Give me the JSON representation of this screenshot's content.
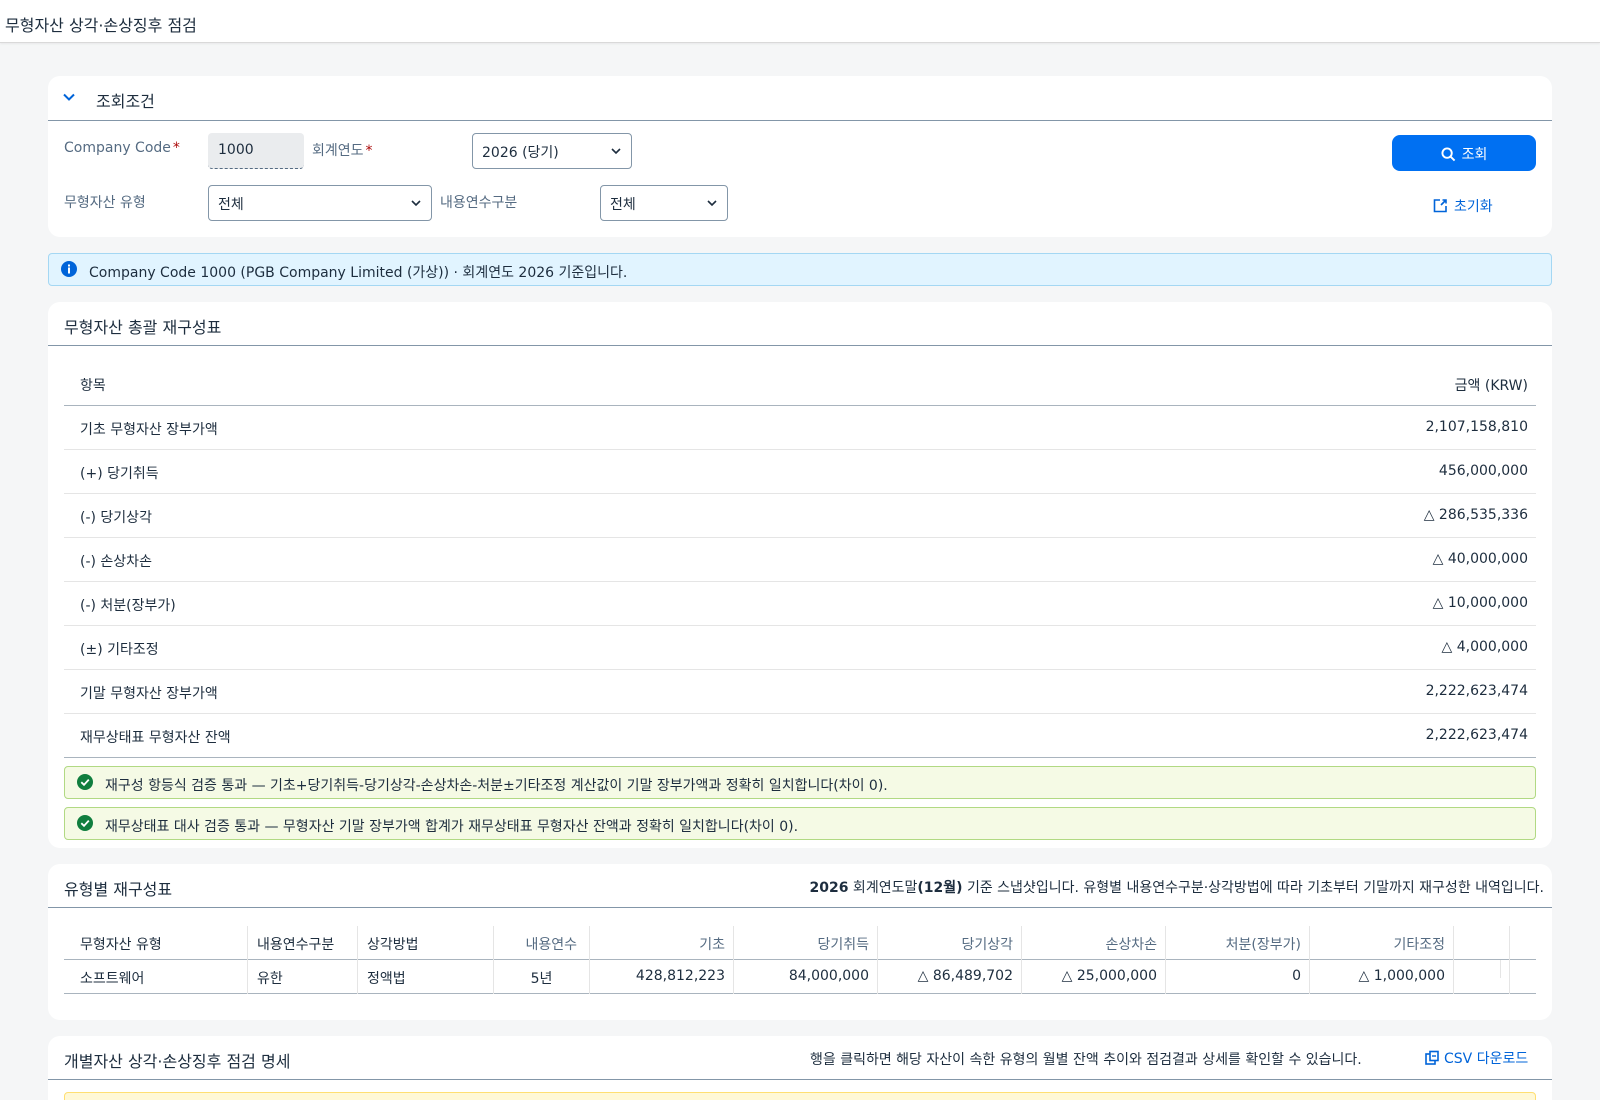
{
  "app": {
    "title": "무형자산 상각·손상징후 점검"
  },
  "filter": {
    "header": "조회조건",
    "company_code_label": "Company Code",
    "company_code_value": "1000",
    "fiscal_year_label": "회계연도",
    "fiscal_year_value": "2026 (당기)",
    "asset_type_label": "무형자산 유형",
    "asset_type_value": "전체",
    "useful_life_label": "내용연수구분",
    "useful_life_value": "전체",
    "search_button": "조회",
    "reset_button": "초기화",
    "required_mark": "*"
  },
  "info": {
    "text": "Company Code 1000 (PGB Company Limited (가상)) · 회계연도 2026 기준입니다."
  },
  "summary": {
    "title": "무형자산 총괄 재구성표",
    "col_item": "항목",
    "col_amount": "금액 (KRW)",
    "rows": [
      {
        "item": "기초 무형자산 장부가액",
        "amount": "2,107,158,810"
      },
      {
        "item": "(+) 당기취득",
        "amount": "456,000,000"
      },
      {
        "item": "(-) 당기상각",
        "amount": "△ 286,535,336"
      },
      {
        "item": "(-) 손상차손",
        "amount": "△ 40,000,000"
      },
      {
        "item": "(-) 처분(장부가)",
        "amount": "△ 10,000,000"
      },
      {
        "item": "(±) 기타조정",
        "amount": "△ 4,000,000"
      },
      {
        "item": "기말 무형자산 장부가액",
        "amount": "2,222,623,474"
      },
      {
        "item": "재무상태표 무형자산 잔액",
        "amount": "2,222,623,474"
      }
    ],
    "check1": "재구성 항등식 검증 통과 — 기초+당기취득-당기상각-손상차손-처분±기타조정 계산값이 기말 장부가액과 정확히 일치합니다(차이 0).",
    "check2": "재무상태표 대사 검증 통과 — 무형자산 기말 장부가액 합계가 재무상태표 무형자산 잔액과 정확히 일치합니다(차이 0)."
  },
  "types": {
    "title": "유형별 재구성표",
    "note_year": "2026",
    "note_mid": " 회계연도말",
    "note_month": "(12월)",
    "note_rest": " 기준 스냅샷입니다. 유형별 내용연수구분·상각방법에 따라 기초부터 기말까지 재구성한 내역입니다.",
    "headers": [
      "무형자산 유형",
      "내용연수구분",
      "상각방법",
      "내용연수",
      "기초",
      "당기취득",
      "당기상각",
      "손상차손",
      "처분(장부가)",
      "기타조정"
    ],
    "rows": [
      [
        "소프트웨어",
        "유한",
        "정액법",
        "5년",
        "428,812,223",
        "84,000,000",
        "△ 86,489,702",
        "△ 25,000,000",
        "0",
        "△ 1,000,000"
      ]
    ]
  },
  "detail": {
    "title": "개별자산 상각·손상징후 점검 명세",
    "note": "행을 클릭하면 해당 자산이 속한 유형의 월별 잔액 추이와 점검결과 상세를 확인할 수 있습니다.",
    "csv_label": "CSV 다운로드"
  },
  "colors": {
    "accent": "#0070f2",
    "link": "#0064d9",
    "success": "#107e3e",
    "info": "#0064d9"
  }
}
